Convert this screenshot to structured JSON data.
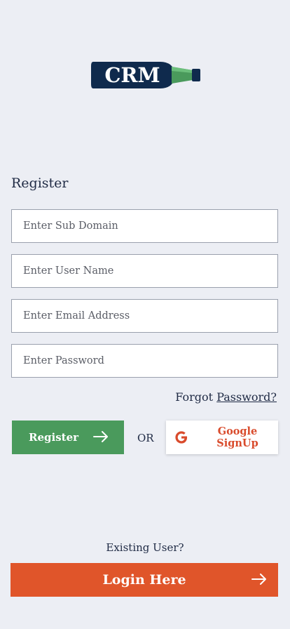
{
  "brand": {
    "logo_text": "CRM",
    "bottle_color": "#0f2a4d",
    "neck_color": "#4a9a5c"
  },
  "register": {
    "title": "Register",
    "subdomain_placeholder": "Enter Sub Domain",
    "username_placeholder": "Enter User Name",
    "email_placeholder": "Enter Email Address",
    "password_placeholder": "Enter Password",
    "forgot_prefix": "Forgot",
    "forgot_link": "Password?",
    "register_button": "Register",
    "or_text": "OR",
    "google_button": "Google SignUp"
  },
  "login": {
    "existing_user": "Existing User?",
    "login_button": "Login Here"
  },
  "icons": {
    "register_arrow": "arrow-right-icon",
    "google": "google-icon",
    "login_arrow": "arrow-right-icon"
  },
  "colors": {
    "background": "#eceef4",
    "register_green": "#4a9a5c",
    "google_red": "#d94b2c",
    "login_orange": "#e0552a",
    "text_navy": "#1f2a44"
  }
}
